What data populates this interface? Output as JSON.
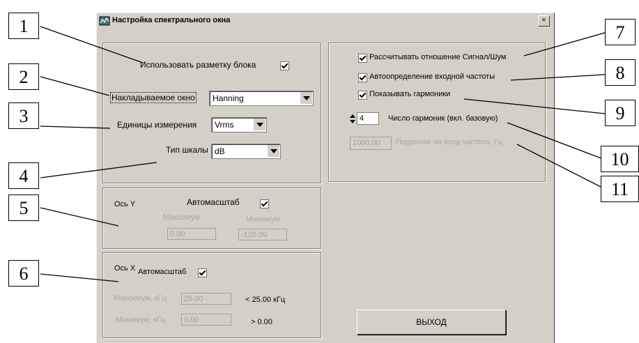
{
  "dialog": {
    "title": "Настройка спектрального окна",
    "close_label": "×"
  },
  "block": {
    "use_block_markup_label": "Использовать разметку блока",
    "use_block_markup_checked": true,
    "window_label": "Накладываемое окно",
    "window_value": "Hanning",
    "units_label": "Единицы измерения",
    "units_value": "Vrms",
    "scale_label": "Тип шкалы",
    "scale_value": "dB"
  },
  "axis_y": {
    "title": "Ось Y",
    "autoscale_label": "Автомасштаб",
    "autoscale_checked": true,
    "max_label": "Максимум",
    "max_value": "0.00",
    "min_label": "Минимум",
    "min_value": "-120.00"
  },
  "axis_x": {
    "title": "Ось X",
    "autoscale_label": "Автомасштаб",
    "autoscale_checked": true,
    "max_label": "Максимум, кГц",
    "max_value": "25.00",
    "max_hint": "< 25.00 кГц",
    "min_label": "Минимум, кГц",
    "min_value": "0.00",
    "min_hint": "> 0.00"
  },
  "options": {
    "snr_label": "Рассчитывать отношение Сигнал/Шум",
    "snr_checked": true,
    "auto_freq_label": "Автоопределение входной частоты",
    "auto_freq_checked": true,
    "show_harmonics_label": "Показывать гармоники",
    "show_harmonics_checked": true,
    "harmonics_count_value": "4",
    "harmonics_count_label": "Число гармоник (вкл. базовую)",
    "input_freq_value": "1000.00",
    "input_freq_label": "Поданная на вход частота, Гц"
  },
  "exit_label": "ВЫХОД",
  "callouts": [
    "1",
    "2",
    "3",
    "4",
    "5",
    "6",
    "7",
    "8",
    "9",
    "10",
    "11"
  ]
}
